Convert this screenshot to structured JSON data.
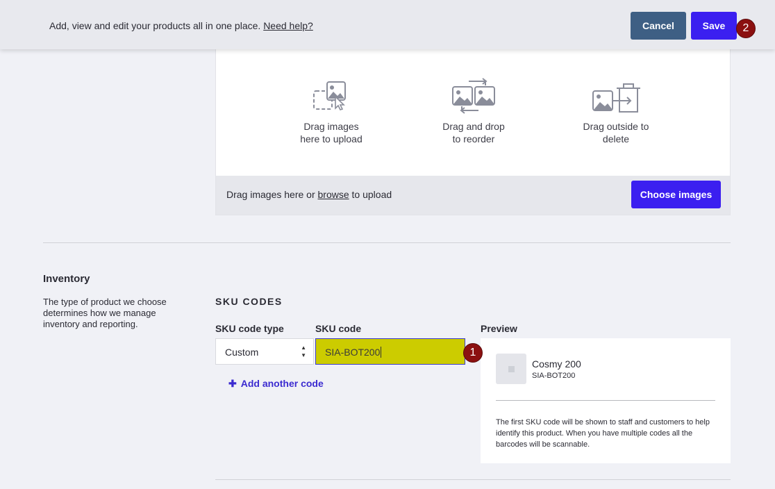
{
  "header": {
    "message": "Add, view and edit your products all in one place.",
    "help_link": "Need help?",
    "cancel_label": "Cancel",
    "save_label": "Save"
  },
  "markers": {
    "first": "1",
    "second": "2"
  },
  "upload": {
    "items": [
      {
        "line1": "Drag images",
        "line2": "here to upload",
        "icon": "upload-image-icon"
      },
      {
        "line1": "Drag and drop",
        "line2": "to reorder",
        "icon": "reorder-images-icon"
      },
      {
        "line1": "Drag outside to",
        "line2": "delete",
        "icon": "delete-image-icon"
      }
    ],
    "bar_prefix": "Drag images here or ",
    "bar_link": "browse",
    "bar_suffix": " to upload",
    "choose_label": "Choose images"
  },
  "inventory": {
    "title": "Inventory",
    "description": "The type of product we choose determines how we manage inventory and reporting.",
    "sku_heading": "SKU CODES",
    "type_label": "SKU code type",
    "code_label": "SKU code",
    "type_value": "Custom",
    "code_value": "SIA-BOT200",
    "add_another": "Add another code",
    "preview": {
      "label": "Preview",
      "product_name": "Cosmy 200",
      "sku": "SIA-BOT200",
      "note": "The first SKU code will be shown to staff and customers to help identify this product. When you have multiple codes all the barcodes will be scannable."
    }
  },
  "colors": {
    "primary": "#3b1ff0",
    "cancel": "#3e5f84",
    "highlight": "#cccc00",
    "marker": "#8b1010"
  }
}
